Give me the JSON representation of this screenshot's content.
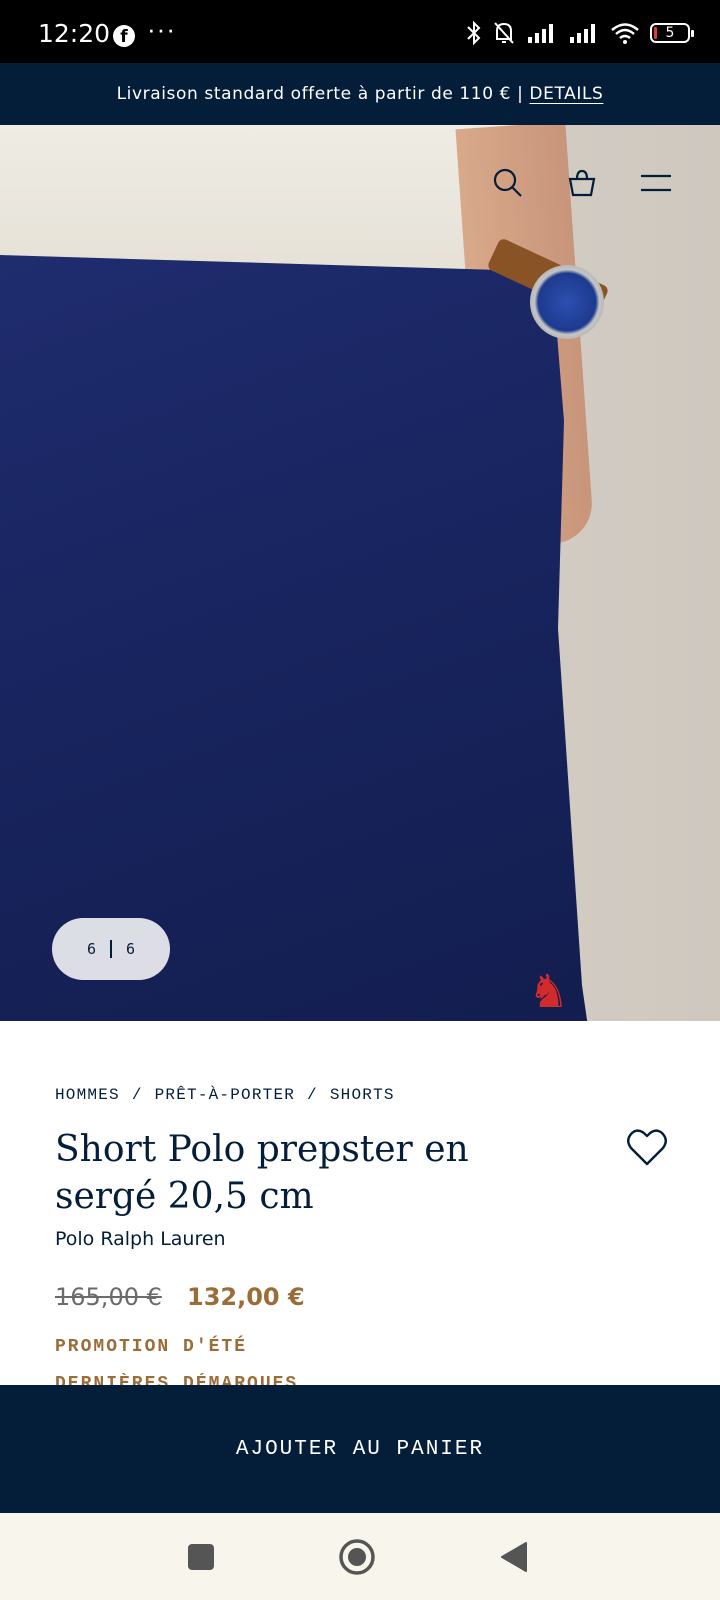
{
  "status_bar": {
    "time": "12:20",
    "app_icon": "facebook-icon",
    "more": "···",
    "battery": "5"
  },
  "banner": {
    "text": "Livraison standard offerte à partir de 110 € | ",
    "link": "DETAILS"
  },
  "gallery": {
    "current": "6",
    "total": "6"
  },
  "breadcrumb": [
    "HOMMES",
    "PRÊT-À-PORTER",
    "SHORTS"
  ],
  "product": {
    "title": "Short Polo prepster en sergé 20,5 cm",
    "brand": "Polo Ralph Lauren",
    "price_old": "165,00 €",
    "price_new": "132,00 €",
    "promo": "PROMOTION D'ÉTÉ",
    "promo_extra": "DERNIÈRES DÉMARQUES"
  },
  "cart_button": {
    "label": "AJOUTER AU PANIER"
  },
  "colors": {
    "navy": "#041e3a",
    "price_accent": "#9b6c37"
  }
}
